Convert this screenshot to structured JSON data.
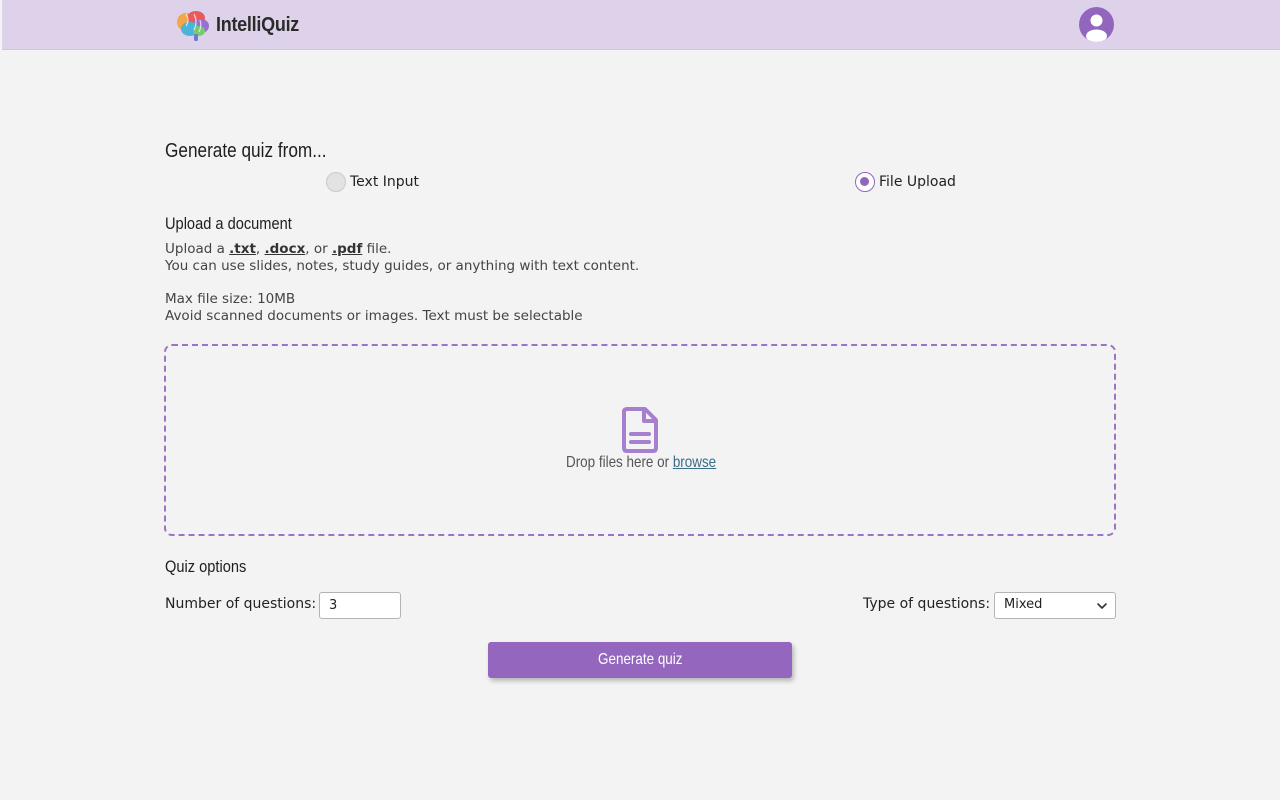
{
  "header": {
    "app_name": "IntelliQuiz",
    "logo_icon": "brain-icon",
    "profile_icon": "user-avatar-icon",
    "bar_color": "#ded1ea",
    "accent_color": "#9265bf"
  },
  "source": {
    "heading": "Generate quiz from...",
    "options": [
      {
        "label": "Text Input",
        "selected": false
      },
      {
        "label": "File Upload",
        "selected": true
      }
    ]
  },
  "upload": {
    "heading": "Upload a document",
    "line1_prefix": "Upload a ",
    "ext_txt": ".txt",
    "sep1": ", ",
    "ext_docx": ".docx",
    "sep2": ", or ",
    "ext_pdf": ".pdf",
    "line1_suffix": " file.",
    "line2": "You can use slides, notes, study guides, or anything with text content.",
    "max_size": "Max file size: 10MB",
    "note": "Avoid scanned documents or images. Text must be selectable",
    "dropzone": {
      "icon": "document-icon",
      "prompt": "Drop files here or ",
      "browse_label": "browse"
    }
  },
  "quiz_options": {
    "heading": "Quiz options",
    "num_questions_label": "Number of questions:",
    "num_questions_value": "3",
    "type_label": "Type of questions:",
    "type_value": "Mixed"
  },
  "actions": {
    "generate_label": "Generate quiz"
  }
}
